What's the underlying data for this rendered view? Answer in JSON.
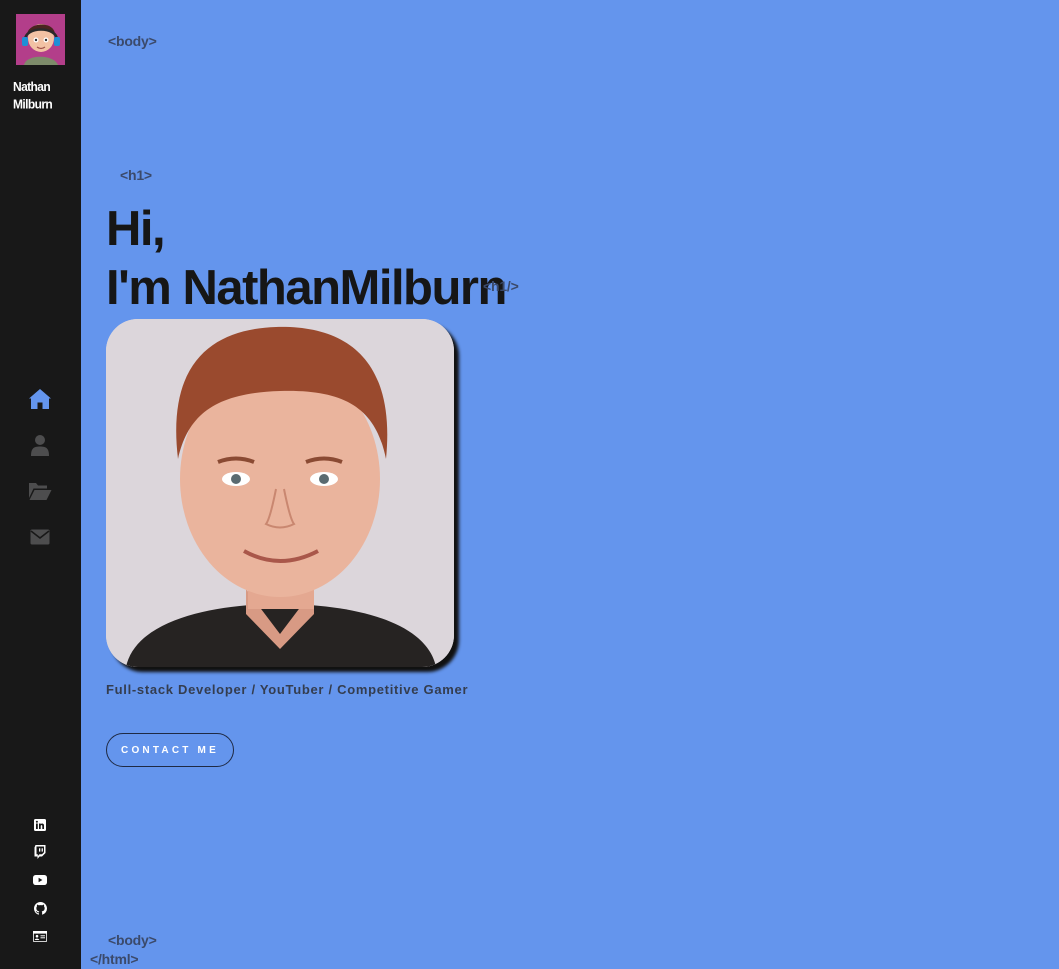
{
  "sidebar": {
    "logo_name_line1": "Nathan",
    "logo_name_line2": "Milburn",
    "nav": [
      {
        "icon": "home-icon",
        "active": true
      },
      {
        "icon": "user-icon",
        "active": false
      },
      {
        "icon": "folder-open-icon",
        "active": false
      },
      {
        "icon": "envelope-icon",
        "active": false
      }
    ],
    "social": [
      "linkedin-icon",
      "twitch-icon",
      "youtube-icon",
      "github-icon",
      "id-card-icon"
    ]
  },
  "tags": {
    "body_open": "<body>",
    "h1_open": "<h1>",
    "h1_close": "<h1/>",
    "body_close": "<body>",
    "html_close": "</html>"
  },
  "hero": {
    "line1": "Hi,",
    "line2": "I'm NathanMilburn",
    "subtitle": "Full-stack Developer / YouTuber / Competitive Gamer",
    "contact_label": "CONTACT ME"
  },
  "colors": {
    "background": "#6495ed",
    "sidebar": "#181818",
    "nav_active": "#6495ed",
    "nav_inactive": "#4d4d4e"
  }
}
